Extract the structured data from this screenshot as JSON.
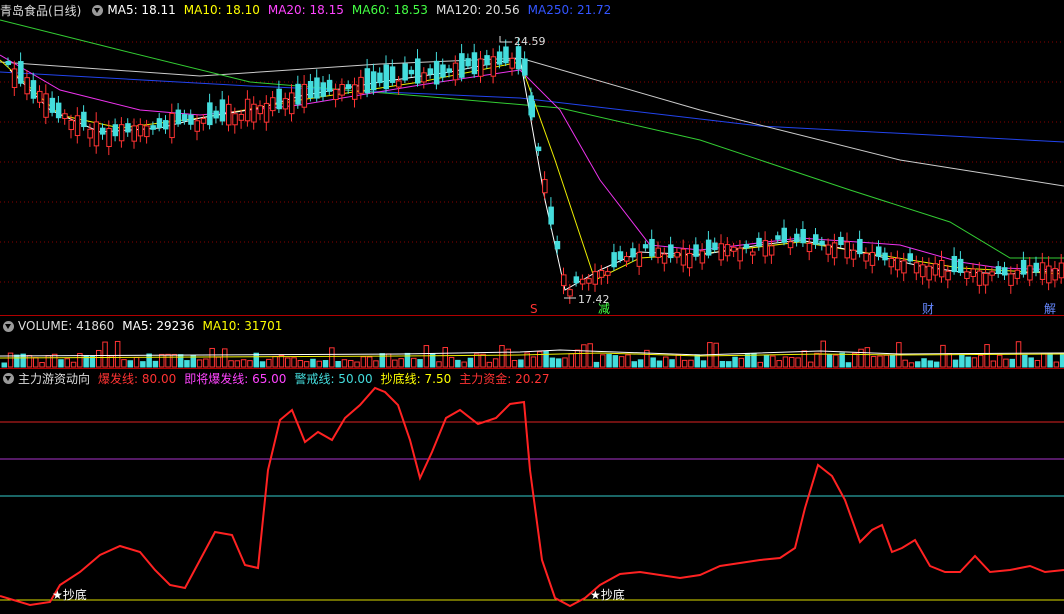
{
  "kline_panel": {
    "stock_name": "青岛食品(日线)",
    "ma_items": [
      {
        "label": "MA5: 18.11",
        "color": "#ffffff"
      },
      {
        "label": "MA10: 18.10",
        "color": "#ffff00"
      },
      {
        "label": "MA20: 18.15",
        "color": "#ff44ff"
      },
      {
        "label": "MA60: 18.53",
        "color": "#44ff44"
      },
      {
        "label": "MA120: 20.56",
        "color": "#dddddd"
      },
      {
        "label": "MA250: 21.72",
        "color": "#3355ff"
      }
    ],
    "high_label": "24.59",
    "low_label": "17.42",
    "markers": [
      {
        "text": "S",
        "color": "#ff3333"
      },
      {
        "text": "减",
        "color": "#44ff44"
      },
      {
        "text": "财",
        "color": "#6688ff"
      },
      {
        "text": "解",
        "color": "#6688ff"
      }
    ]
  },
  "volume_panel": {
    "title": "VOLUME: 41860",
    "ma5": "MA5: 29236",
    "ma10": "MA10: 31701",
    "colors": {
      "title": "#dddddd",
      "ma5": "#ffffff",
      "ma10": "#ffff00"
    }
  },
  "indicator_panel": {
    "title": "主力游资动向",
    "items": [
      {
        "label": "爆发线: 80.00",
        "color": "#ff3333"
      },
      {
        "label": "即将爆发线: 65.00",
        "color": "#ff44ff"
      },
      {
        "label": "警戒线: 50.00",
        "color": "#44dddd"
      },
      {
        "label": "抄底线: 7.50",
        "color": "#ffff00"
      },
      {
        "label": "主力资金: 20.27",
        "color": "#ff3333"
      }
    ],
    "bottom_signals": [
      "★抄底",
      "★抄底"
    ]
  }
}
